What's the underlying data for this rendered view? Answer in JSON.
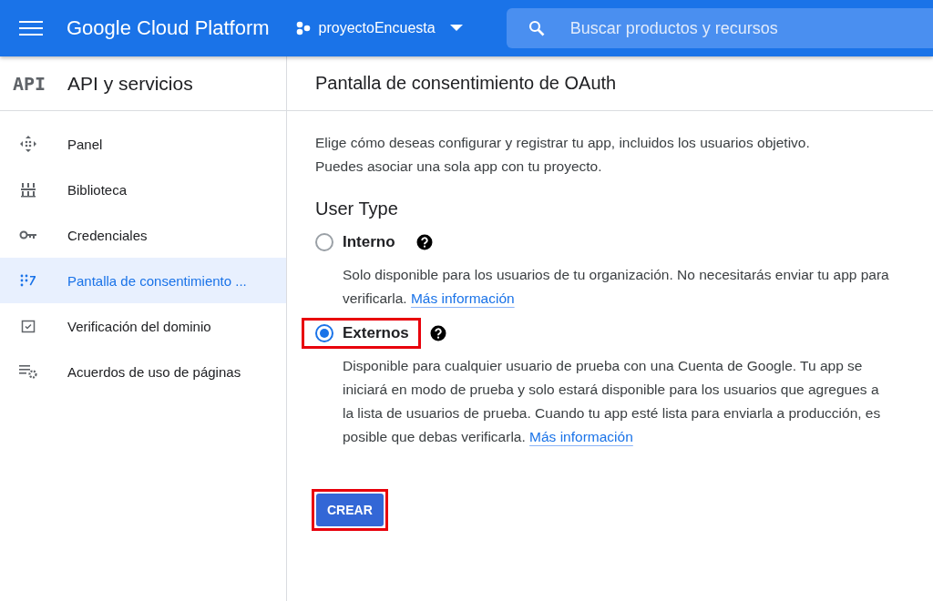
{
  "topbar": {
    "product": "Google Cloud Platform",
    "project": "proyectoEncuesta",
    "search": {
      "placeholder": "Buscar productos y recursos"
    }
  },
  "sidebar": {
    "badge": "API",
    "title": "API y servicios",
    "items": [
      {
        "label": "Panel",
        "kind": "dashboard",
        "selected": false
      },
      {
        "label": "Biblioteca",
        "kind": "library",
        "selected": false
      },
      {
        "label": "Credenciales",
        "kind": "credentials",
        "selected": false
      },
      {
        "label": "Pantalla de consentimiento ...",
        "kind": "consent",
        "selected": true
      },
      {
        "label": "Verificación del dominio",
        "kind": "verification",
        "selected": false
      },
      {
        "label": "Acuerdos de uso de páginas",
        "kind": "agreements",
        "selected": false
      }
    ]
  },
  "page": {
    "title": "Pantalla de consentimiento de OAuth",
    "intro": "Elige cómo deseas configurar y registrar tu app, incluidos los usuarios objetivo. Puedes asociar una sola app con tu proyecto.",
    "section": "User Type",
    "options": [
      {
        "label": "Interno",
        "selected": false,
        "highlighted": false,
        "description": "Solo disponible para los usuarios de tu organización. No necesitarás enviar tu app para verificarla.",
        "link": "Más información"
      },
      {
        "label": "Externos",
        "selected": true,
        "highlighted": true,
        "description": "Disponible para cualquier usuario de prueba con una Cuenta de Google. Tu app se iniciará en modo de prueba y solo estará disponible para los usuarios que agregues a la lista de usuarios de prueba. Cuando tu app esté lista para enviarla a producción, es posible que debas verificarla.",
        "link": "Más información"
      }
    ],
    "create_button": {
      "label": "CREAR",
      "highlighted": true
    }
  }
}
